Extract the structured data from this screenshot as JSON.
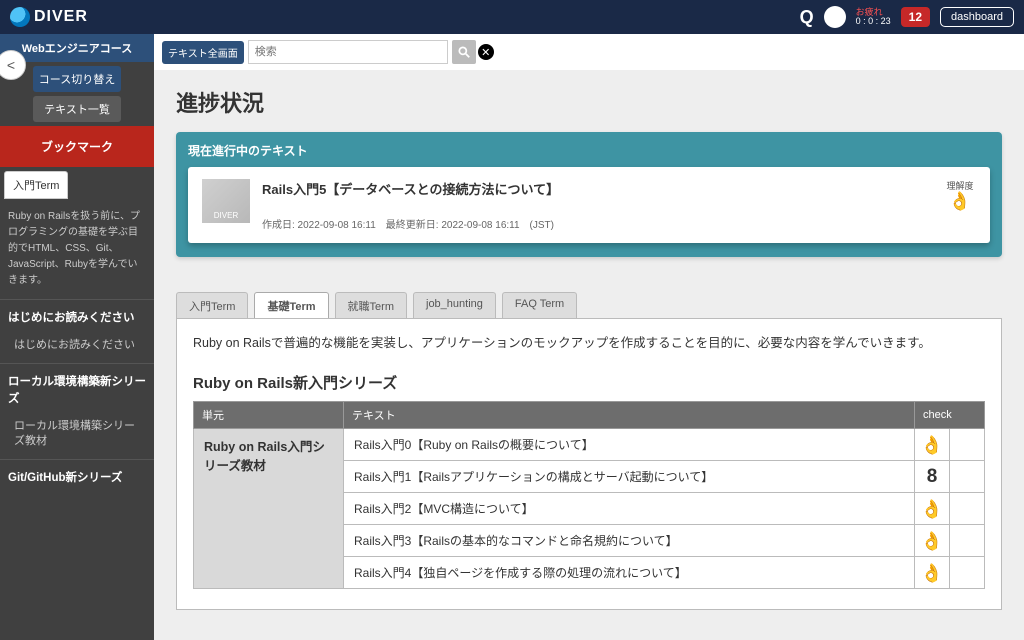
{
  "header": {
    "brand": "DIVER",
    "timerLabel": "お疲れ",
    "timer": "0 : 0 : 23",
    "badge": "12",
    "dashboard": "dashboard"
  },
  "sidebar": {
    "courseTitle": "Webエンジニアコース",
    "switchCourse": "コース切り替え",
    "textList": "テキスト一覧",
    "bookmark": "ブックマーク",
    "tab": "入門Term",
    "desc": "Ruby on Railsを扱う前に、プログラミングの基礎を学ぶ目的でHTML、CSS、Git、JavaScript、Rubyを学んでいきます。",
    "sec1Head": "はじめにお読みください",
    "sec1Item": "はじめにお読みください",
    "sec2Head": "ローカル環境構築新シリーズ",
    "sec2Item": "ローカル環境構築シリーズ教材",
    "sec3Head": "Git/GitHub新シリーズ"
  },
  "search": {
    "tag": "テキスト全画面",
    "placeholder": "検索"
  },
  "page": {
    "title": "進捗状況",
    "currentLabel": "現在進行中のテキスト",
    "currentTitle": "Rails入門5【データベースとの接続方法について】",
    "currentMeta": "作成日: 2022-09-08 16:11　最終更新日: 2022-09-08 16:11　(JST)",
    "rikai": "理解度",
    "thumb": "DIVER"
  },
  "tabs": [
    "入門Term",
    "基礎Term",
    "就職Term",
    "job_hunting",
    "FAQ Term"
  ],
  "activeTab": 1,
  "termDesc": "Ruby on Railsで普遍的な機能を実装し、アプリケーションのモックアップを作成することを目的に、必要な内容を学んでいきます。",
  "seriesTitle": "Ruby on Rails新入門シリーズ",
  "table": {
    "hUnit": "単元",
    "hText": "テキスト",
    "hCheck": "check",
    "unit": "Ruby on Rails入門シリーズ教材",
    "rows": [
      {
        "text": "Rails入門0【Ruby on Railsの概要について】",
        "icon": "ok"
      },
      {
        "text": "Rails入門1【Railsアプリケーションの構成とサーバ起動について】",
        "icon": "8"
      },
      {
        "text": "Rails入門2【MVC構造について】",
        "icon": "ok"
      },
      {
        "text": "Rails入門3【Railsの基本的なコマンドと命名規約について】",
        "icon": "ok"
      },
      {
        "text": "Rails入門4【独自ページを作成する際の処理の流れについて】",
        "icon": "ok"
      }
    ]
  }
}
